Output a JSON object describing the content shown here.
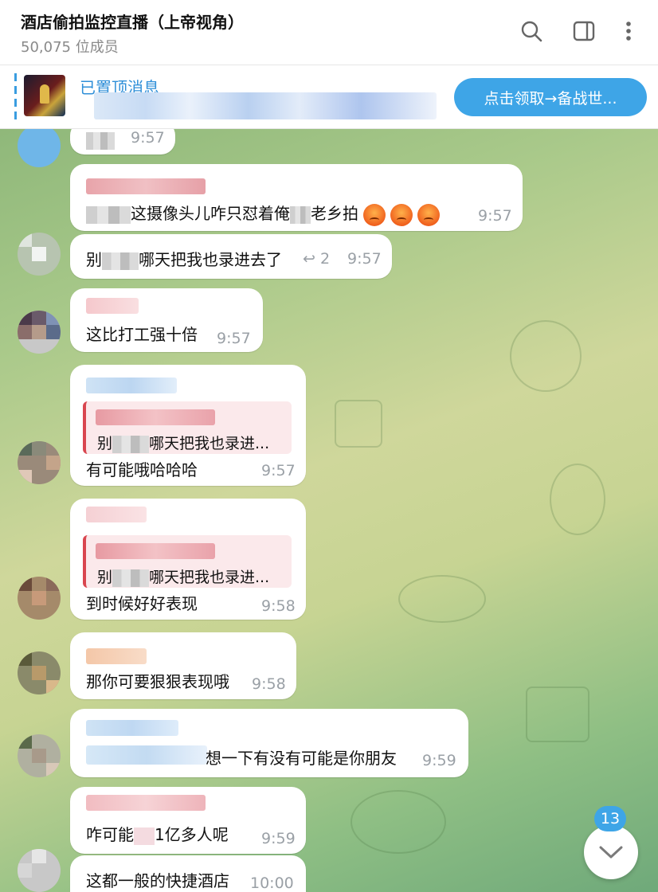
{
  "header": {
    "title": "酒店偷拍监控直播（上帝视角）",
    "subtitle": "50,075 位成员",
    "icons": [
      "search-icon",
      "sidebar-toggle-icon",
      "more-vertical-icon"
    ]
  },
  "pinned": {
    "label": "已置顶消息",
    "button_label": "点击领取→备战世..."
  },
  "messages": [
    {
      "text": "",
      "time": "9:57"
    },
    {
      "text_a": "这摄像头儿咋只怼着俺",
      "text_b": "老乡拍",
      "time": "9:57",
      "emoji": [
        "angry-face-icon",
        "angry-face-icon",
        "angry-face-icon"
      ]
    },
    {
      "text_a": "别",
      "text_b": "哪天把我也录进去了",
      "reply_count": "2",
      "time": "9:57"
    },
    {
      "text": "这比打工强十倍",
      "time": "9:57"
    },
    {
      "reply_a": "别",
      "reply_b": "哪天把我也录进...",
      "text": "有可能哦哈哈哈",
      "time": "9:57"
    },
    {
      "reply_a": "别",
      "reply_b": "哪天把我也录进...",
      "text": "到时候好好表现",
      "time": "9:58"
    },
    {
      "text": "那你可要狠狠表现哦",
      "time": "9:58"
    },
    {
      "text": "想一下有没有可能是你朋友",
      "time": "9:59"
    },
    {
      "text_a": "咋可能",
      "text_b": "1亿多人呢",
      "time": "9:59"
    },
    {
      "text": "这都一般的快捷酒店",
      "time": "10:00"
    }
  ],
  "unread_badge": "13",
  "colors": {
    "accent": "#3ea5e7",
    "reply_bar": "#d9464f"
  }
}
